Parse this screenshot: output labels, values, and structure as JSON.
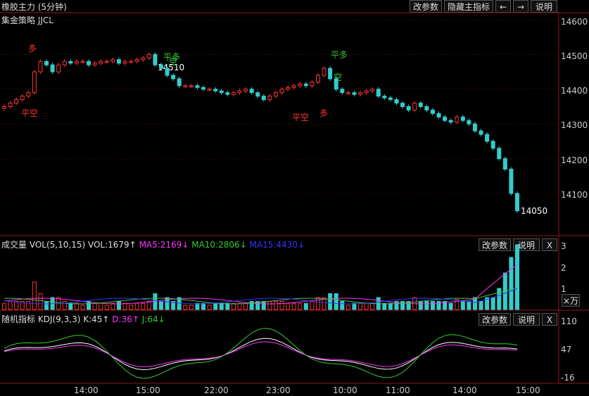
{
  "header": {
    "title": "橡胶主力 (5分钟)",
    "buttons": {
      "modify": "改参数",
      "hide_main": "隐藏主指标",
      "prev": "←",
      "next": "→",
      "help": "说明"
    }
  },
  "main": {
    "strategy_label": "集金策略  JJCL",
    "y_ticks": [
      "14600",
      "14500",
      "14400",
      "14300",
      "14200",
      "14100"
    ],
    "annotations": {
      "high_price": "14510",
      "low_price": "14050",
      "signals": [
        "多",
        "平空",
        "平多",
        "空",
        "平多",
        "空",
        "平空",
        "多"
      ]
    }
  },
  "volume": {
    "title": "成交量",
    "name": "VOL(5,10,15)",
    "vol": "VOL:1679↑",
    "ma5": "MA5:2169↓",
    "ma10": "MA10:2806↓",
    "ma15": "MA15:4430↓",
    "y_ticks": [
      "3",
      "2",
      "1"
    ],
    "unit": "×万",
    "buttons": {
      "modify": "改参数",
      "help": "说明",
      "close": "X"
    }
  },
  "kdj": {
    "title": "随机指标",
    "name": "KDJ(9,3,3)",
    "k": "K:45↑",
    "d": "D:36↑",
    "j": "J:64↓",
    "y_ticks": [
      "110",
      "47",
      "-16"
    ],
    "buttons": {
      "modify": "改参数",
      "help": "说明",
      "close": "X"
    }
  },
  "x_ticks": [
    "14:00",
    "15:00",
    "22:00",
    "23:00",
    "10:00",
    "11:00",
    "14:00",
    "15:00"
  ],
  "colors": {
    "up": "#ff3333",
    "down": "#33cccc",
    "ma5": "#ff33ff",
    "ma10": "#33cc33",
    "ma15": "#3333ff",
    "k": "#ffffff",
    "d": "#ff33ff",
    "j": "#33cc33"
  },
  "chart_data": {
    "type": "line",
    "title": "橡胶主力 (5分钟)",
    "y_range": [
      14030,
      14620
    ],
    "close_series_approx": [
      14350,
      14360,
      14370,
      14380,
      14390,
      14450,
      14480,
      14470,
      14450,
      14470,
      14480,
      14475,
      14480,
      14480,
      14470,
      14475,
      14480,
      14480,
      14485,
      14475,
      14480,
      14480,
      14485,
      14490,
      14500,
      14470,
      14460,
      14440,
      14430,
      14410,
      14410,
      14410,
      14405,
      14400,
      14400,
      14395,
      14390,
      14385,
      14390,
      14395,
      14400,
      14390,
      14380,
      14370,
      14380,
      14390,
      14400,
      14405,
      14410,
      14415,
      14410,
      14420,
      14440,
      14460,
      14430,
      14400,
      14390,
      14390,
      14385,
      14390,
      14395,
      14400,
      14380,
      14375,
      14370,
      14360,
      14350,
      14340,
      14360,
      14350,
      14340,
      14330,
      14320,
      14310,
      14305,
      14320,
      14310,
      14300,
      14280,
      14270,
      14250,
      14230,
      14200,
      14170,
      14100,
      14050
    ]
  }
}
